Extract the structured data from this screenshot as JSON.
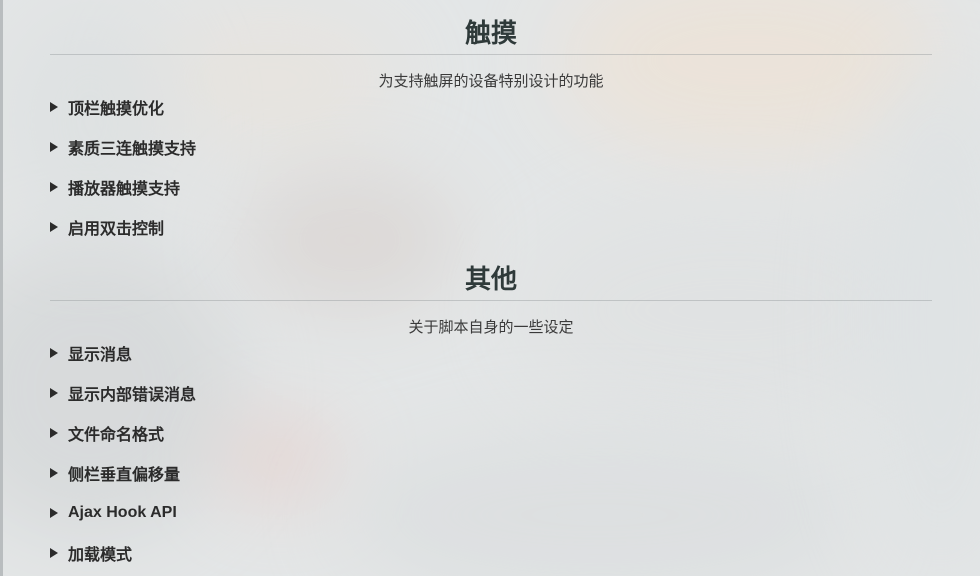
{
  "sections": [
    {
      "title": "触摸",
      "description": "为支持触屏的设备特别设计的功能",
      "options": [
        {
          "label": "顶栏触摸优化"
        },
        {
          "label": "素质三连触摸支持"
        },
        {
          "label": "播放器触摸支持"
        },
        {
          "label": "启用双击控制"
        }
      ]
    },
    {
      "title": "其他",
      "description": "关于脚本自身的一些设定",
      "options": [
        {
          "label": "显示消息"
        },
        {
          "label": "显示内部错误消息"
        },
        {
          "label": "文件命名格式"
        },
        {
          "label": "侧栏垂直偏移量"
        },
        {
          "label": "Ajax Hook API"
        },
        {
          "label": "加载模式"
        }
      ]
    }
  ],
  "icons": {
    "collapse_marker": "triangle-right-icon"
  }
}
